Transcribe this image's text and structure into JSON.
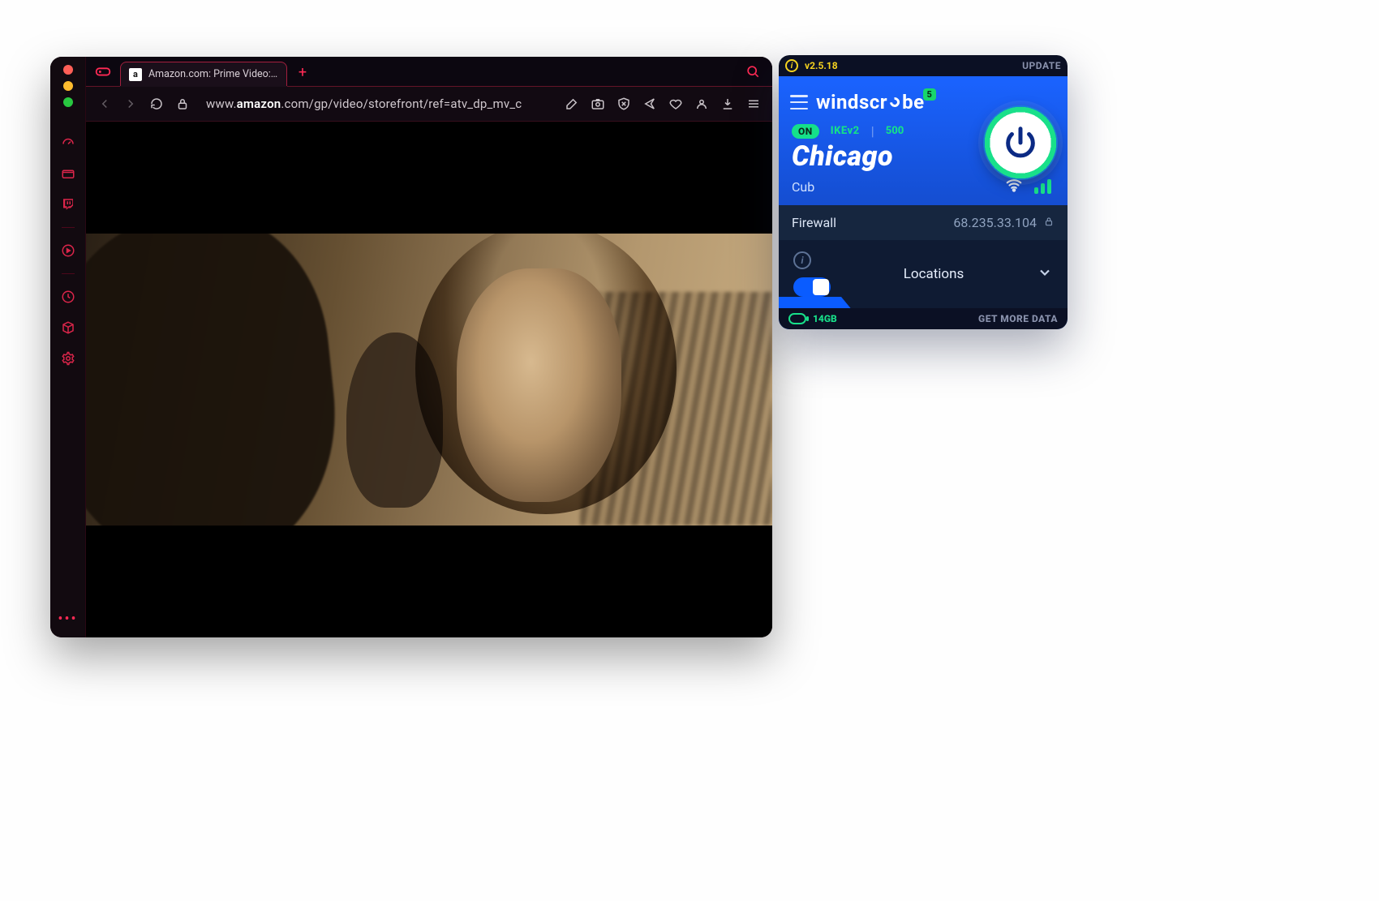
{
  "browser": {
    "tab_title": "Amazon.com: Prime Video: Prim",
    "tab_favicon_letter": "a",
    "url_prefix": "www.",
    "url_host_bold": "amazon",
    "url_rest": ".com/gp/video/storefront/ref=atv_dp_mv_c"
  },
  "windscribe": {
    "version": "v2.5.18",
    "update_label": "UPDATE",
    "brand_pre": "windscr",
    "brand_post": "be",
    "badge": "5",
    "status_on": "ON",
    "protocol": "IKEv2",
    "port": "500",
    "city": "Chicago",
    "server": "Cub",
    "firewall_label": "Firewall",
    "ip": "68.235.33.104",
    "locations_label": "Locations",
    "data_left": "14GB",
    "get_more": "GET MORE DATA"
  }
}
